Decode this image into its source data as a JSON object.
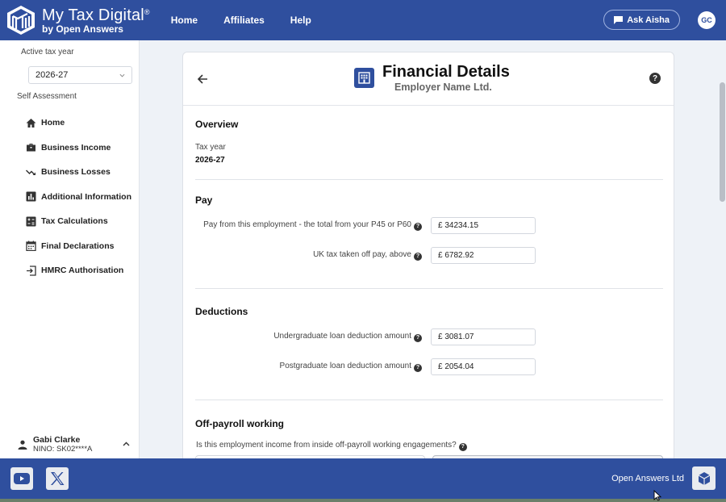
{
  "header": {
    "brand_title": "My Tax Digital",
    "brand_mark": "®",
    "brand_sub": "by Open Answers",
    "nav": [
      "Home",
      "Affiliates",
      "Help"
    ],
    "ask_label": "Ask Aisha",
    "avatar_initials": "GC",
    "bg_color": "#2f4f9e"
  },
  "sidebar": {
    "tax_year_label": "Active tax year",
    "tax_year_value": "2026-27",
    "section_label": "Self Assessment",
    "items": [
      {
        "label": "Home",
        "icon": "home-icon"
      },
      {
        "label": "Business Income",
        "icon": "briefcase-icon"
      },
      {
        "label": "Business Losses",
        "icon": "trending-down-icon"
      },
      {
        "label": "Additional Information",
        "icon": "bar-chart-icon"
      },
      {
        "label": "Tax Calculations",
        "icon": "calculator-icon"
      },
      {
        "label": "Final Declarations",
        "icon": "calendar-icon"
      },
      {
        "label": "HMRC Authorisation",
        "icon": "login-icon"
      }
    ],
    "user_name": "Gabi Clarke",
    "user_nino": "NINO: SK02****A"
  },
  "card": {
    "title": "Financial Details",
    "subtitle": "Employer Name Ltd.",
    "overview": {
      "title": "Overview",
      "tax_year_label": "Tax year",
      "tax_year_value": "2026-27"
    },
    "pay": {
      "title": "Pay",
      "fields": [
        {
          "label": "Pay from this employment - the total from your P45 or P60",
          "value": "£ 34234.15"
        },
        {
          "label": "UK tax taken off pay, above",
          "value": "£ 6782.92"
        }
      ]
    },
    "deductions": {
      "title": "Deductions",
      "fields": [
        {
          "label": "Undergraduate loan deduction amount",
          "value": "£ 3081.07"
        },
        {
          "label": "Postgraduate loan deduction amount",
          "value": "£ 2054.04"
        }
      ]
    },
    "off_payroll": {
      "title": "Off-payroll working",
      "question": "Is this employment income from inside off-payroll working engagements?"
    }
  },
  "footer": {
    "company": "Open Answers Ltd",
    "social": [
      "youtube-icon",
      "x-icon"
    ]
  }
}
